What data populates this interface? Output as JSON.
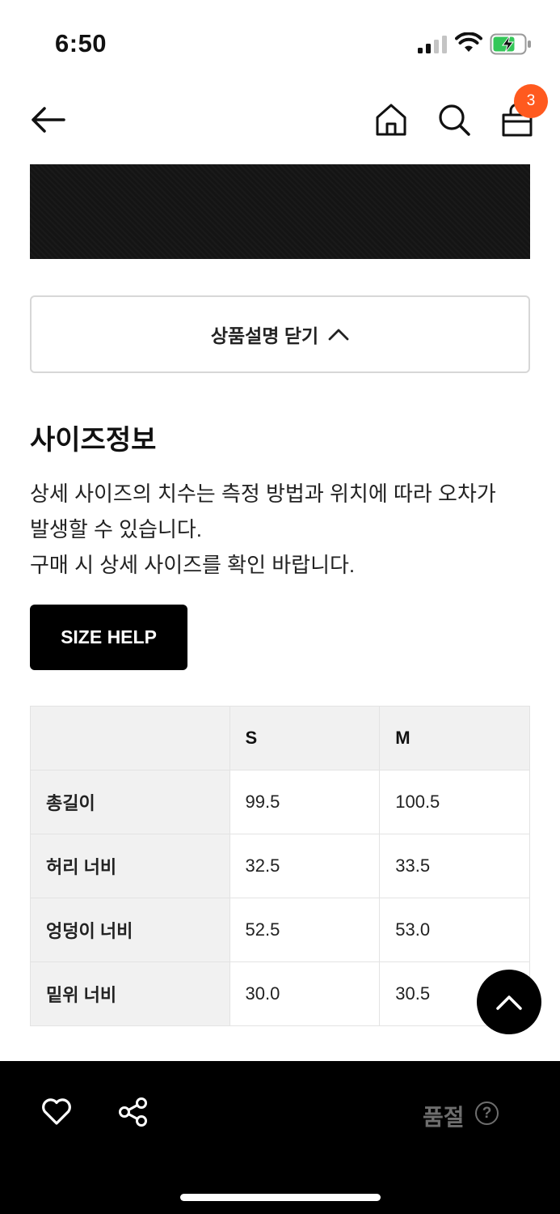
{
  "status_bar": {
    "time": "6:50",
    "icons": [
      "cellular-signal-icon",
      "wifi-icon",
      "battery-charging-icon"
    ]
  },
  "nav": {
    "icons": [
      "back-arrow-icon",
      "home-icon",
      "search-icon",
      "shopping-bag-icon"
    ],
    "cart_count": "3"
  },
  "product_detail": {
    "collapse_label": "상품설명 닫기"
  },
  "size_info": {
    "title": "사이즈정보",
    "description_lines": [
      "상세 사이즈의 치수는 측정 방법과 위치에 따라 오차가",
      "발생할 수 있습니다.",
      "구매 시 상세 사이즈를 확인 바랍니다."
    ],
    "size_help_label": "SIZE HELP",
    "table": {
      "headers": [
        "",
        "S",
        "M"
      ],
      "rows": [
        [
          "총길이",
          "99.5",
          "100.5"
        ],
        [
          "허리 너비",
          "32.5",
          "33.5"
        ],
        [
          "엉덩이 너비",
          "52.5",
          "53.0"
        ],
        [
          "밑위 너비",
          "30.0",
          "30.5"
        ]
      ]
    }
  },
  "bottom_bar": {
    "icons": [
      "heart-icon",
      "share-icon",
      "question-circle-icon"
    ],
    "soldout_label": "품절",
    "help_symbol": "?"
  },
  "colors": {
    "badge": "#ff5a1f",
    "battery_charge": "#34c759",
    "bottom_bar": "#000000",
    "soldout_text": "#6e6e6e"
  }
}
